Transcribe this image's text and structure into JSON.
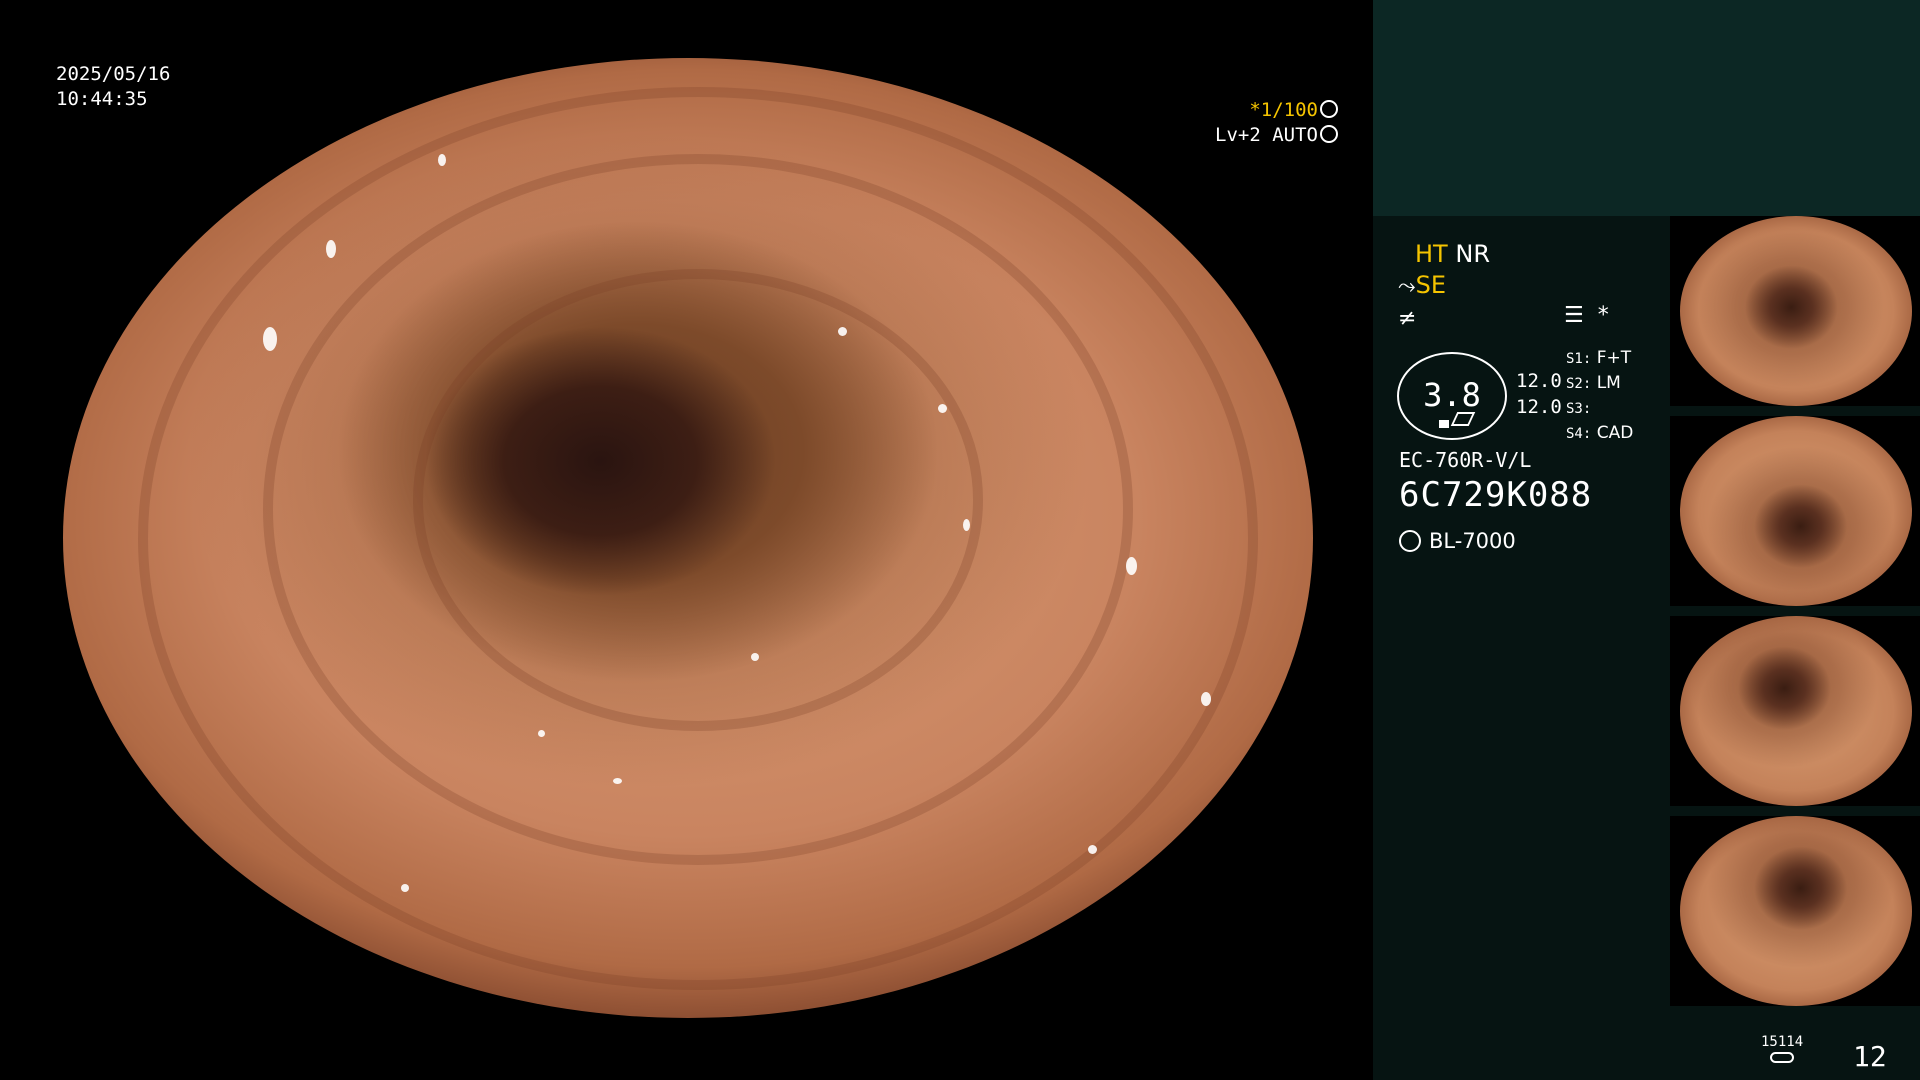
{
  "overlay": {
    "date": "2025/05/16",
    "time": "10:44:35",
    "shutter": "*1/100",
    "iris": "Lv+2 AUTO"
  },
  "panel": {
    "ht": "HT",
    "nr": "NR",
    "se": "SE",
    "asterisk": "*",
    "scope_value": "3.8",
    "num1": "12.0",
    "num2": "12.0",
    "switches": [
      {
        "label": "S1:",
        "value": "F+T"
      },
      {
        "label": "S2:",
        "value": "LM"
      },
      {
        "label": "S3:",
        "value": ""
      },
      {
        "label": "S4:",
        "value": "CAD"
      }
    ],
    "model": "EC-760R-V/L",
    "serial": "6C729K088",
    "light_source": "BL-7000"
  },
  "footer": {
    "counter": "15114",
    "image_count": "12"
  },
  "icons": [
    "shutter-symbol-icon",
    "iris-symbol-icon",
    "structure-enhance-icon",
    "color-enhance-icon",
    "waveform-icon",
    "light-source-icon",
    "storage-icon"
  ]
}
